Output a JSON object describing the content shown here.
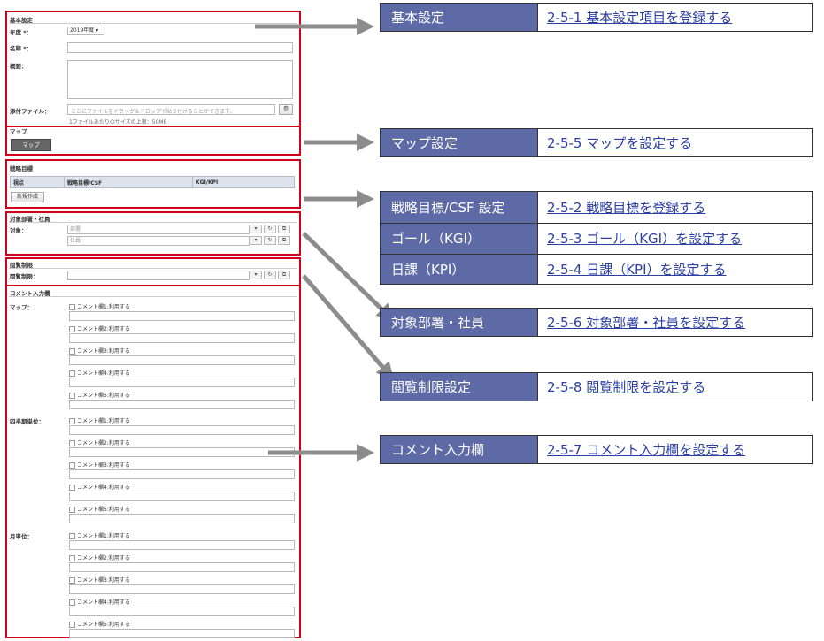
{
  "form": {
    "basic": {
      "title": "基本設定",
      "year_label": "年度 *：",
      "year_value": "2019年度 ▾",
      "name_label": "名称 *：",
      "summary_label": "概要：",
      "attach_label": "添付ファイル：",
      "attach_placeholder": "ここにファイルをドラッグ＆ドロップで貼り付けることができます。",
      "attach_btn": "参",
      "attach_note": "1ファイルあたりのサイズの上限：50MB"
    },
    "map": {
      "title": "マップ",
      "button": "マップ"
    },
    "strategy": {
      "title": "戦略目標",
      "col1": "視点",
      "col2": "戦略目標/CSF",
      "col3": "KGI/KPI",
      "new_button": "新規作成"
    },
    "target": {
      "title": "対象部署・社員",
      "label": "対象：",
      "dept": "部署",
      "emp": "社員"
    },
    "view": {
      "title": "閲覧制限",
      "label": "閲覧制限："
    },
    "comment": {
      "title": "コメント入力欄",
      "groups": [
        {
          "label": "マップ：",
          "items": [
            "コメント欄1:利用する",
            "コメント欄2:利用する",
            "コメント欄3:利用する",
            "コメント欄4:利用する",
            "コメント欄5:利用する"
          ]
        },
        {
          "label": "四半期単位：",
          "items": [
            "コメント欄1:利用する",
            "コメント欄2:利用する",
            "コメント欄3:利用する",
            "コメント欄4:利用する",
            "コメント欄5:利用する"
          ]
        },
        {
          "label": "月単位：",
          "items": [
            "コメント欄1:利用する",
            "コメント欄2:利用する",
            "コメント欄3:利用する",
            "コメント欄4:利用する",
            "コメント欄5:利用する"
          ]
        }
      ]
    }
  },
  "callouts": [
    {
      "left": "基本設定",
      "right": "2-5-1 基本設定項目を登録する"
    },
    {
      "left": "マップ設定",
      "right": "2-5-5 マップを設定する"
    },
    {
      "left": "戦略目標/CSF 設定",
      "right": "2-5-2 戦略目標を登録する"
    },
    {
      "left": "ゴール（KGI）",
      "right": "2-5-3 ゴール（KGI）を設定する"
    },
    {
      "left": "日課（KPI）",
      "right": "2-5-4 日課（KPI）を設定する"
    },
    {
      "left": "対象部署・社員",
      "right": "2-5-6 対象部署・社員を設定する"
    },
    {
      "left": "閲覧制限設定",
      "right": "2-5-8 閲覧制限を設定する"
    },
    {
      "left": "コメント入力欄",
      "right": "2-5-7 コメント入力欄を設定する"
    }
  ],
  "colors": {
    "frame": "#d0021b",
    "callout_bg": "#5e6aa5",
    "link": "#2c3fa3",
    "arrow": "#8c8c8c"
  }
}
